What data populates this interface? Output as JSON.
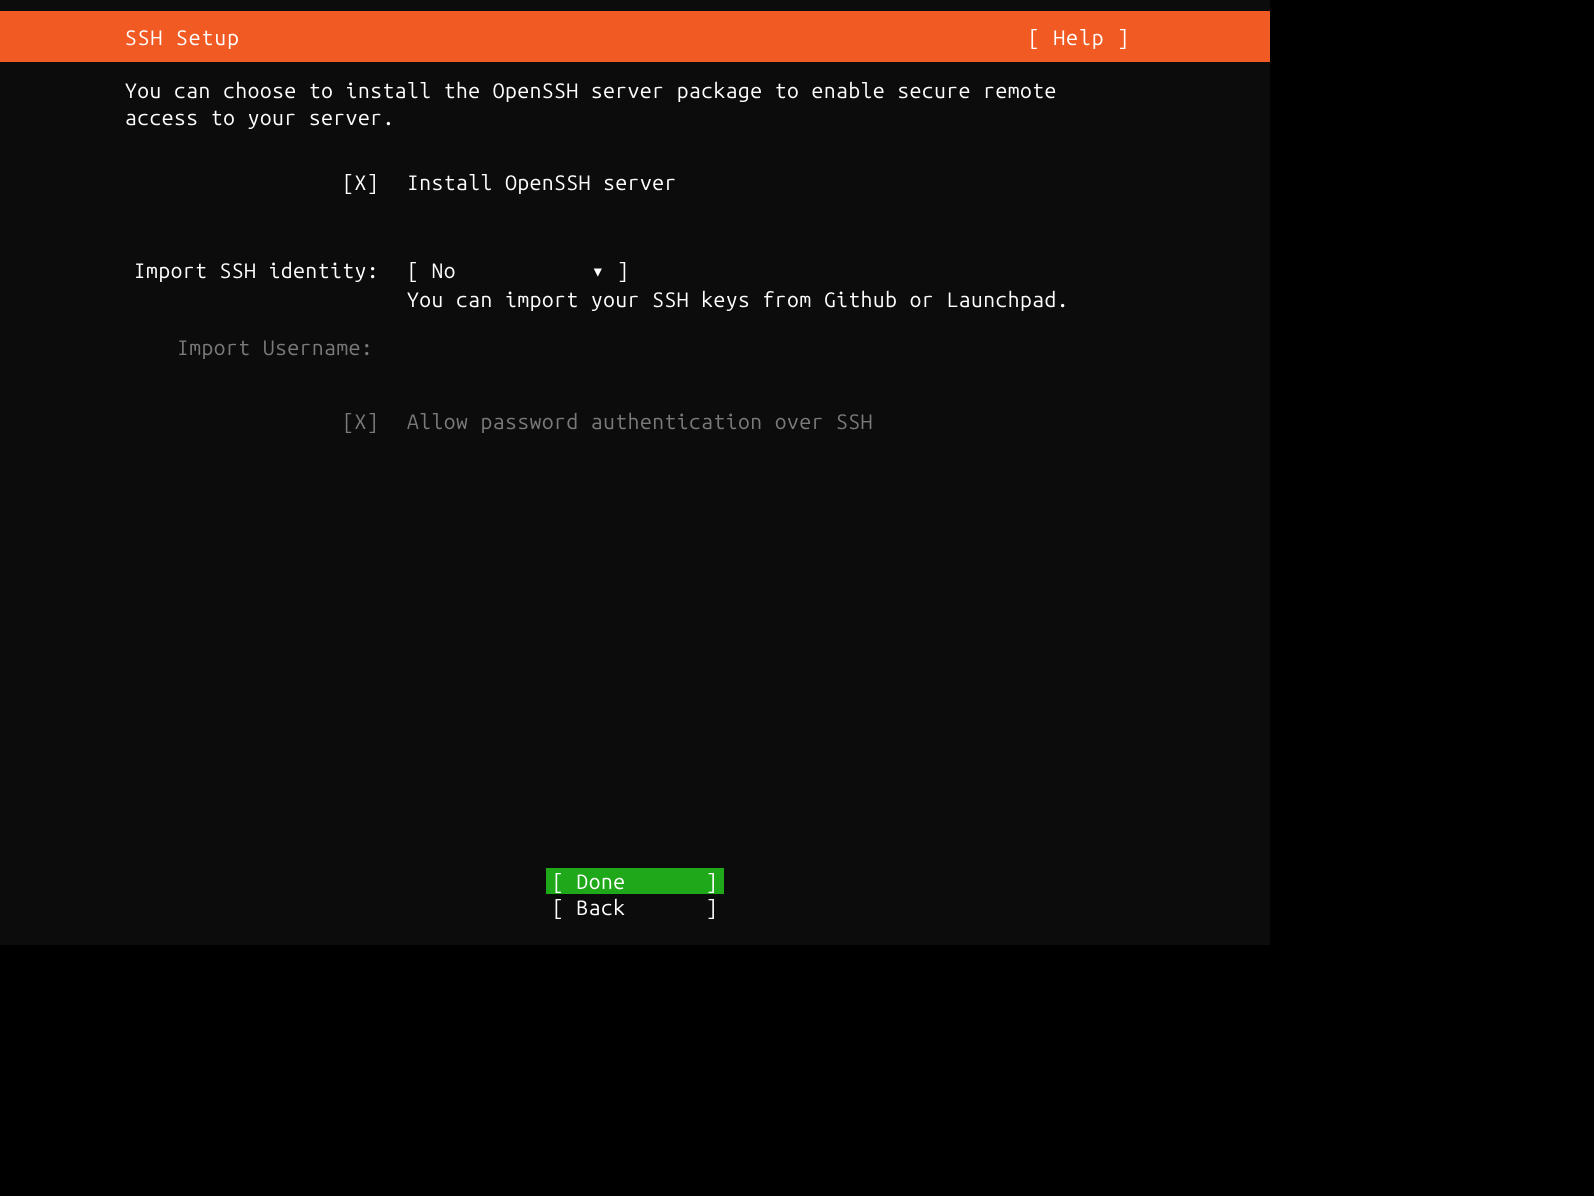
{
  "header": {
    "title": "SSH Setup",
    "help": "[ Help ]"
  },
  "main": {
    "description": "You can choose to install the OpenSSH server package to enable secure remote access to your server.",
    "install_checkbox": "[X]",
    "install_label": "Install OpenSSH server",
    "import_identity_label": "Import SSH identity:",
    "import_identity_value_open": "[ ",
    "import_identity_value_text": "No",
    "import_identity_value_arrow": "▾",
    "import_identity_value_close": " ]",
    "import_identity_hint": "You can import your SSH keys from Github or Launchpad.",
    "import_username_label": "Import Username:",
    "allow_password_checkbox": "[X]",
    "allow_password_label": "Allow password authentication over SSH"
  },
  "footer": {
    "done_open": "[ ",
    "done_text": "Done",
    "done_close": "]",
    "back_open": "[ ",
    "back_text": "Back",
    "back_close": "]"
  }
}
